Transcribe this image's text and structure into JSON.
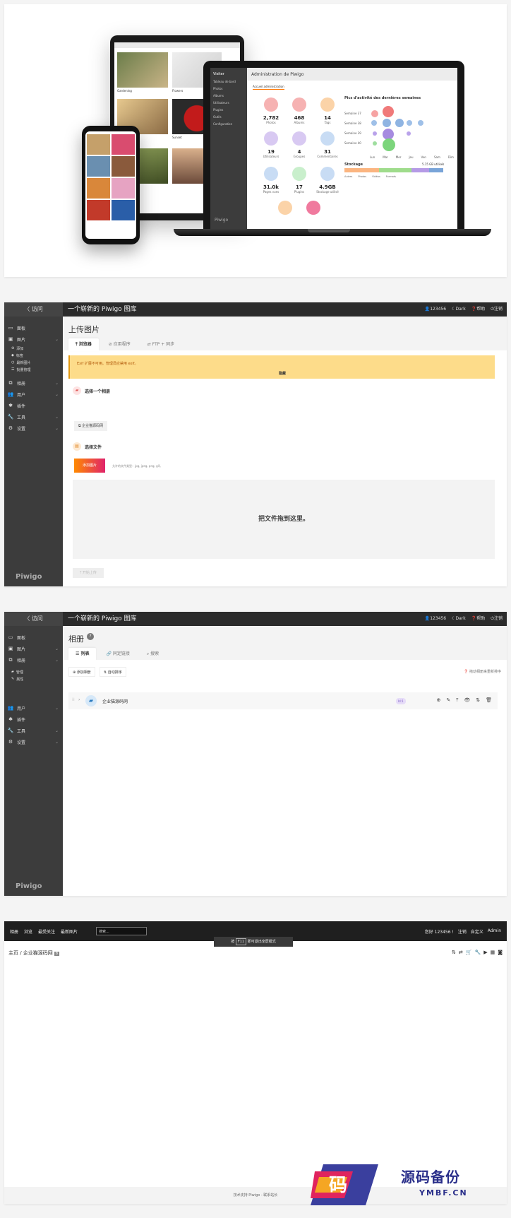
{
  "hero": {
    "tablet_captions": [
      "Gardening",
      "Flowers",
      "Sunset"
    ],
    "laptop": {
      "side_head": "Visiter",
      "side_items": [
        "Tableau de bord",
        "Photos",
        "Albums",
        "Utilisateurs",
        "Plugins",
        "Outils",
        "Configuration"
      ],
      "side_logo": "Piwigo",
      "title": "Administration de Piwigo",
      "tab": "Accueil administration",
      "stats": [
        {
          "value": "2,782",
          "label": "Photos",
          "color": "#f6b2b2"
        },
        {
          "value": "468",
          "label": "Albums",
          "color": "#f6b2b2"
        },
        {
          "value": "14",
          "label": "Tags",
          "color": "#fbd3a8"
        },
        {
          "value": "19",
          "label": "Utilisateurs",
          "color": "#d8c9f2"
        },
        {
          "value": "4",
          "label": "Groupes",
          "color": "#d8c9f2"
        },
        {
          "value": "31",
          "label": "Commentaires",
          "color": "#c8dcf4"
        },
        {
          "value": "31.0k",
          "label": "Pages vues",
          "color": "#c8dcf4"
        },
        {
          "value": "17",
          "label": "Plugins",
          "color": "#c9efcc"
        },
        {
          "value": "4.9GB",
          "label": "Stockage utilisé",
          "color": "#c8dcf4"
        }
      ],
      "chart_title": "Pics d'activité des dernières semaines",
      "weeks": [
        "Semaine 37",
        "Semaine 38",
        "Semaine 39",
        "Semaine 40"
      ],
      "days": [
        "Lun",
        "Mar",
        "Mer",
        "Jeu",
        "Ven",
        "Sam",
        "Dim"
      ],
      "storage_title": "Stockage",
      "storage_value": "5.15 GB utilisés",
      "storage_legend": [
        "Autres",
        "Photos",
        "Vidéos",
        "Formats"
      ]
    }
  },
  "upload_panel": {
    "visit": "〈 访问",
    "gallery_title": "一个崭新的 Piwigo 图库",
    "top_right": [
      "123456",
      "Dark",
      "帮助",
      "注销"
    ],
    "sidebar": {
      "items": [
        "面板",
        "图片",
        "相册",
        "用户",
        "插件",
        "工具",
        "设置"
      ],
      "sub_items": [
        "添加",
        "标签",
        "最新图片",
        "批量管理"
      ],
      "logo": "Piwigo"
    },
    "title": "上传图片",
    "tabs": [
      "浏览器",
      "应用程序",
      "FTP + 同步"
    ],
    "warning": "Exif 扩展不可用。管理员应禁用 exif。",
    "warning_hide": "隐藏",
    "step1": "选择一个相册",
    "album_chip": "企业猫源码网",
    "step2": "选择文件",
    "add_photos": "添加图片",
    "allowed": "允许的文件类型：jpg, jpeg, png, gif。",
    "dropzone": "把文件拖到这里。",
    "start": "开始上传"
  },
  "albums_panel": {
    "visit": "〈 访问",
    "gallery_title": "一个崭新的 Piwigo 图库",
    "top_right": [
      "123456",
      "Dark",
      "帮助",
      "注销"
    ],
    "sidebar": {
      "items": [
        "面板",
        "图片",
        "相册",
        "用户",
        "插件",
        "工具",
        "设置"
      ],
      "sub_items": [
        "管理",
        "属性"
      ],
      "logo": "Piwigo"
    },
    "title": "相册",
    "help": "?",
    "tabs": [
      "列表",
      "同定链接",
      "搜索"
    ],
    "add_album": "添加相册",
    "auto_sort": "自动排序",
    "drag_note": "拖动相册来重新排序",
    "album": {
      "name": "企业猫源码网",
      "badge": "Id:1"
    }
  },
  "gallery_panel": {
    "nav": [
      "相册",
      "浏览",
      "最受关注",
      "最新图片"
    ],
    "search_placeholder": "搜索...",
    "right": [
      "您好 123456 !",
      "注销",
      "自定义",
      "Admin"
    ],
    "f11_prefix": "按",
    "f11_key": "F11",
    "f11_suffix": "即可退出全屏模式",
    "breadcrumb": "主页 / 企业猫源码网",
    "breadcrumb_count": "8",
    "footer": "技术支持 Piwigo - 联系站长"
  },
  "watermark": {
    "cn": "源码备份",
    "en": "YMBF.CN",
    "glyph": "码"
  }
}
